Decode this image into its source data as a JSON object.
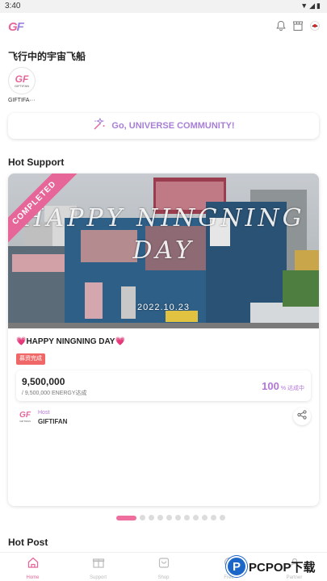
{
  "status_bar": {
    "time": "3:40",
    "icons": "▼◢▮"
  },
  "header": {
    "logo_g": "G",
    "logo_f": "F",
    "icons": [
      "bell-icon",
      "shop-icon",
      "flag-icon"
    ]
  },
  "profile": {
    "display_name": "飞行中的宇宙飞船",
    "avatar_logo": "GF",
    "avatar_sub": "GIFTIFAN",
    "avatar_label": "GIFTIFA···"
  },
  "community_button": {
    "label": "Go, UNIVERSE COMMUNITY!"
  },
  "hot_support": {
    "title": "Hot Support",
    "card": {
      "ribbon": "COMPLETED",
      "overlay_title": "HAPPY NINGNING DAY",
      "overlay_date": "2022.10.23",
      "title": "💗HAPPY NINGNING DAY💗",
      "badge": "募资完成",
      "energy_amount": "9,500,000",
      "energy_sub": "/ 9,500,000 ENERGY达成",
      "percent": "100",
      "percent_unit": "% 达成中",
      "host_label": "Host",
      "host_name": "GIFTIFAN",
      "host_logo": "GF",
      "host_logo_sub": "GIFTIFAN"
    }
  },
  "pager": {
    "count": 11,
    "active_index": 0
  },
  "hot_post": {
    "title": "Hot Post"
  },
  "bottom_nav": [
    {
      "label": "Home",
      "icon": "home-icon",
      "active": true
    },
    {
      "label": "Support",
      "icon": "gift-icon",
      "active": false
    },
    {
      "label": "Shop",
      "icon": "bag-icon",
      "active": false
    },
    {
      "label": "Free",
      "icon": "free-icon",
      "active": false
    },
    {
      "label": "Partner",
      "icon": "partner-icon",
      "active": false
    }
  ],
  "watermark": {
    "mark": "P",
    "brand": "PCPOP",
    "suffix": "下载"
  },
  "colors": {
    "accent_pink": "#e7669a",
    "accent_purple": "#b476d9",
    "badge_red": "#f06767"
  }
}
